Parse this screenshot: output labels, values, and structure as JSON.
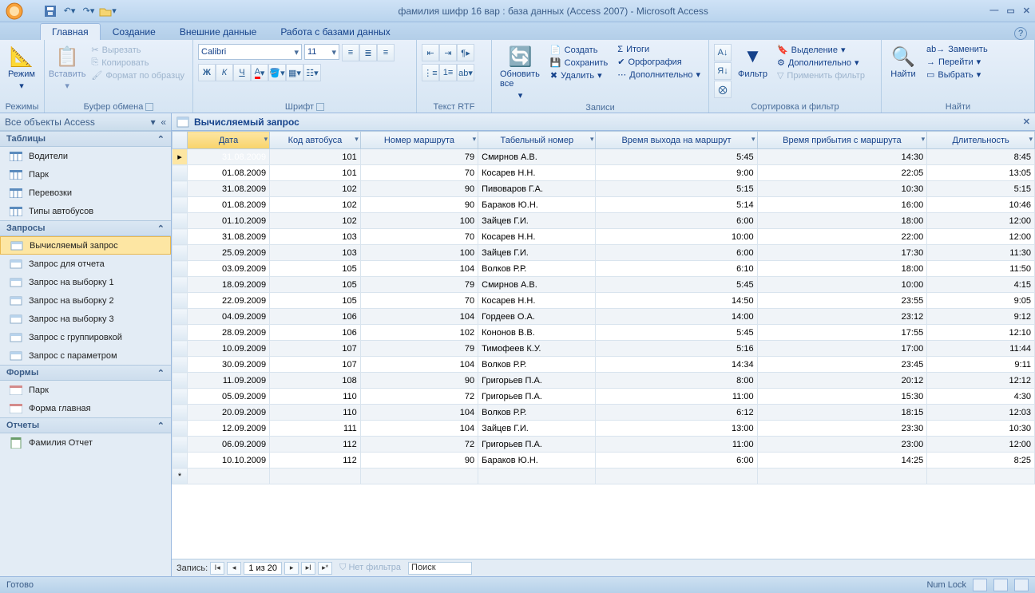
{
  "title": "фамилия шифр 16 вар : база данных (Access 2007) - Microsoft Access",
  "tabs": {
    "home": "Главная",
    "create": "Создание",
    "external": "Внешние данные",
    "dbtools": "Работа с базами данных"
  },
  "ribbon": {
    "modes": {
      "label": "Режимы",
      "btn": "Режим"
    },
    "clipboard": {
      "label": "Буфер обмена",
      "paste": "Вставить",
      "cut": "Вырезать",
      "copy": "Копировать",
      "format": "Формат по образцу"
    },
    "font": {
      "label": "Шрифт",
      "name": "Calibri",
      "size": "11"
    },
    "rtf": {
      "label": "Текст RTF"
    },
    "records": {
      "label": "Записи",
      "refresh": "Обновить все",
      "new": "Создать",
      "save": "Сохранить",
      "delete": "Удалить",
      "totals": "Итоги",
      "spelling": "Орфография",
      "more": "Дополнительно"
    },
    "sort": {
      "label": "Сортировка и фильтр",
      "filter": "Фильтр",
      "selection": "Выделение",
      "advanced": "Дополнительно",
      "apply": "Применить фильтр"
    },
    "find": {
      "label": "Найти",
      "find": "Найти",
      "replace": "Заменить",
      "goto": "Перейти",
      "select": "Выбрать"
    }
  },
  "nav": {
    "header": "Все объекты Access",
    "cats": {
      "tables": "Таблицы",
      "queries": "Запросы",
      "forms": "Формы",
      "reports": "Отчеты"
    },
    "tables": [
      "Водители",
      "Парк",
      "Перевозки",
      "Типы автобусов"
    ],
    "queries": [
      "Вычисляемый запрос",
      "Запрос для отчета",
      "Запрос на выборку 1",
      "Запрос на выборку 2",
      "Запрос на выборку 3",
      "Запрос с группировкой",
      "Запрос с параметром"
    ],
    "forms": [
      "Парк",
      "Форма главная"
    ],
    "reports": [
      "Фамилия Отчет"
    ]
  },
  "doc": {
    "title": "Вычисляемый запрос"
  },
  "columns": [
    "Дата",
    "Код автобуса",
    "Номер маршрута",
    "Табельный номер",
    "Время выхода на маршрут",
    "Время прибытия с маршрута",
    "Длительность"
  ],
  "rows": [
    [
      "31.08.2009",
      "101",
      "79",
      "Смирнов А.В.",
      "5:45",
      "14:30",
      "8:45"
    ],
    [
      "01.08.2009",
      "101",
      "70",
      "Косарев Н.Н.",
      "9:00",
      "22:05",
      "13:05"
    ],
    [
      "31.08.2009",
      "102",
      "90",
      "Пивоваров Г.А.",
      "5:15",
      "10:30",
      "5:15"
    ],
    [
      "01.08.2009",
      "102",
      "90",
      "Бараков Ю.Н.",
      "5:14",
      "16:00",
      "10:46"
    ],
    [
      "01.10.2009",
      "102",
      "100",
      "Зайцев Г.И.",
      "6:00",
      "18:00",
      "12:00"
    ],
    [
      "31.08.2009",
      "103",
      "70",
      "Косарев Н.Н.",
      "10:00",
      "22:00",
      "12:00"
    ],
    [
      "25.09.2009",
      "103",
      "100",
      "Зайцев Г.И.",
      "6:00",
      "17:30",
      "11:30"
    ],
    [
      "03.09.2009",
      "105",
      "104",
      "Волков Р.Р.",
      "6:10",
      "18:00",
      "11:50"
    ],
    [
      "18.09.2009",
      "105",
      "79",
      "Смирнов А.В.",
      "5:45",
      "10:00",
      "4:15"
    ],
    [
      "22.09.2009",
      "105",
      "70",
      "Косарев Н.Н.",
      "14:50",
      "23:55",
      "9:05"
    ],
    [
      "04.09.2009",
      "106",
      "104",
      "Гордеев О.А.",
      "14:00",
      "23:12",
      "9:12"
    ],
    [
      "28.09.2009",
      "106",
      "102",
      "Кононов В.В.",
      "5:45",
      "17:55",
      "12:10"
    ],
    [
      "10.09.2009",
      "107",
      "79",
      "Тимофеев К.У.",
      "5:16",
      "17:00",
      "11:44"
    ],
    [
      "30.09.2009",
      "107",
      "104",
      "Волков Р.Р.",
      "14:34",
      "23:45",
      "9:11"
    ],
    [
      "11.09.2009",
      "108",
      "90",
      "Григорьев П.А.",
      "8:00",
      "20:12",
      "12:12"
    ],
    [
      "05.09.2009",
      "110",
      "72",
      "Григорьев П.А.",
      "11:00",
      "15:30",
      "4:30"
    ],
    [
      "20.09.2009",
      "110",
      "104",
      "Волков Р.Р.",
      "6:12",
      "18:15",
      "12:03"
    ],
    [
      "12.09.2009",
      "111",
      "104",
      "Зайцев Г.И.",
      "13:00",
      "23:30",
      "10:30"
    ],
    [
      "06.09.2009",
      "112",
      "72",
      "Григорьев П.А.",
      "11:00",
      "23:00",
      "12:00"
    ],
    [
      "10.10.2009",
      "112",
      "90",
      "Бараков Ю.Н.",
      "6:00",
      "14:25",
      "8:25"
    ]
  ],
  "recnav": {
    "label": "Запись:",
    "pos": "1 из 20",
    "nofilter": "Нет фильтра",
    "search": "Поиск"
  },
  "status": {
    "ready": "Готово",
    "numlock": "Num Lock"
  }
}
